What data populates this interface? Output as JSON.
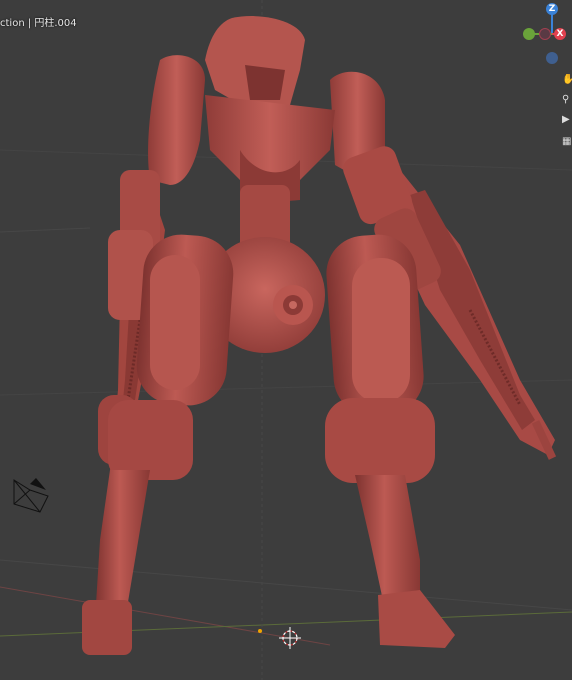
{
  "viewport": {
    "object_label": "ction | 円柱.004"
  },
  "gizmo": {
    "z_label": "Z",
    "x_label": "X",
    "colors": {
      "x": "#e0404e",
      "y": "#6aa33a",
      "z": "#3a82d8",
      "neg": "#3f5f8f"
    }
  },
  "side_toolbar": {
    "icons": [
      "hand-pan-icon",
      "zoom-icon",
      "camera-view-icon"
    ]
  },
  "scene": {
    "background": "#3d3d3d",
    "model_color": "#b5544f",
    "model_name": "mech-robot-model"
  }
}
